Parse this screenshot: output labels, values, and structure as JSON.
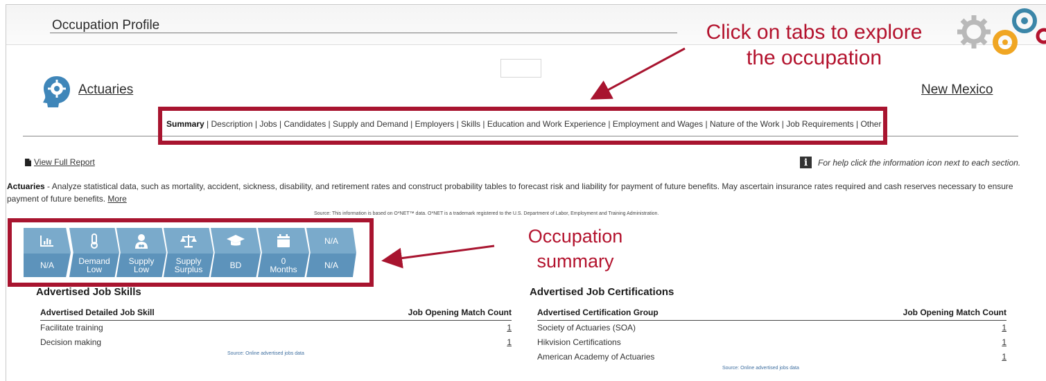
{
  "header": {
    "title": "Occupation Profile"
  },
  "occupation": {
    "name": "Actuaries",
    "state": "New Mexico"
  },
  "tabs": [
    {
      "label": "Summary",
      "active": true
    },
    {
      "label": "Description"
    },
    {
      "label": "Jobs"
    },
    {
      "label": "Candidates"
    },
    {
      "label": "Supply and Demand"
    },
    {
      "label": "Employers"
    },
    {
      "label": "Skills"
    },
    {
      "label": "Education and Work Experience"
    },
    {
      "label": "Employment and Wages"
    },
    {
      "label": "Nature of the Work"
    },
    {
      "label": "Job Requirements"
    },
    {
      "label": "Other"
    }
  ],
  "links": {
    "view_full_report": "View Full Report",
    "help_text": "For help click the information icon next to each section."
  },
  "description": {
    "title": "Actuaries",
    "text": " - Analyze statistical data, such as mortality, accident, sickness, disability, and retirement rates and construct probability tables to forecast risk and liability for payment of future benefits. May ascertain insurance rates required and cash reserves necessary to ensure payment of future benefits. ",
    "more": "More",
    "source": "Source: This information is based on O*NET™ data. O*NET is a trademark registered to the U.S. Department of Labor, Employment and Training Administration."
  },
  "summary_tiles": [
    {
      "icon": "bar-chart-icon",
      "top": "",
      "line1": "N/A",
      "line2": ""
    },
    {
      "icon": "thermometer-icon",
      "top": "",
      "line1": "Demand",
      "line2": "Low"
    },
    {
      "icon": "worker-icon",
      "top": "",
      "line1": "Supply",
      "line2": "Low"
    },
    {
      "icon": "scales-icon",
      "top": "",
      "line1": "Supply",
      "line2": "Surplus"
    },
    {
      "icon": "graduation-cap-icon",
      "top": "",
      "line1": "BD",
      "line2": ""
    },
    {
      "icon": "calendar-icon",
      "top": "",
      "line1": "0",
      "line2": "Months"
    },
    {
      "icon": "",
      "top": "N/A",
      "line1": "N/A",
      "line2": ""
    }
  ],
  "annotations": {
    "tabs_line1": "Click on tabs to explore",
    "tabs_line2": "the occupation",
    "summary_line1": "Occupation",
    "summary_line2": "summary"
  },
  "skills": {
    "title": "Advertised Job Skills",
    "col1": "Advertised Detailed Job Skill",
    "col2": "Job Opening Match Count",
    "rows": [
      {
        "name": "Facilitate training",
        "count": "1"
      },
      {
        "name": "Decision making",
        "count": "1"
      }
    ],
    "source": "Source: Online advertised jobs data"
  },
  "certifications": {
    "title": "Advertised Job Certifications",
    "col1": "Advertised Certification Group",
    "col2": "Job Opening Match Count",
    "rows": [
      {
        "name": "Society of Actuaries (SOA)",
        "count": "1"
      },
      {
        "name": "Hikvision Certifications",
        "count": "1"
      },
      {
        "name": "American Academy of Actuaries",
        "count": "1"
      }
    ],
    "source": "Source: Online advertised jobs data"
  },
  "colors": {
    "annotation_red": "#a8142f",
    "tile_top": "#7aaacb",
    "tile_bottom": "#5d93bb"
  }
}
